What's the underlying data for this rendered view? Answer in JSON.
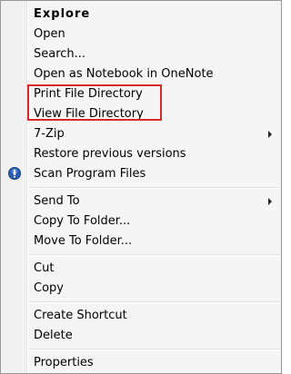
{
  "menu": {
    "items": [
      {
        "label": "Explore"
      },
      {
        "label": "Open"
      },
      {
        "label": "Search..."
      },
      {
        "label": "Open as Notebook in OneNote"
      },
      {
        "label": "Print File Directory"
      },
      {
        "label": "View File Directory"
      },
      {
        "label": "7-Zip"
      },
      {
        "label": "Restore previous versions"
      },
      {
        "label": "Scan Program Files"
      },
      {
        "label": "Send To"
      },
      {
        "label": "Copy To Folder..."
      },
      {
        "label": "Move To Folder..."
      },
      {
        "label": "Cut"
      },
      {
        "label": "Copy"
      },
      {
        "label": "Create Shortcut"
      },
      {
        "label": "Delete"
      },
      {
        "label": "Properties"
      }
    ]
  },
  "icons": {
    "scan": "shield-icon",
    "submenu": "submenu-arrow-icon"
  },
  "colors": {
    "highlight_border": "#d42a2a",
    "menu_background": "#f5f5f5",
    "menu_border": "#979797"
  }
}
